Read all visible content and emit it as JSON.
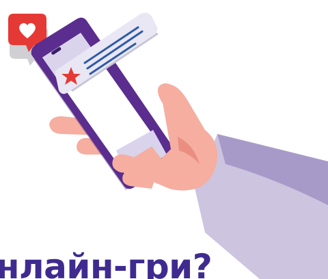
{
  "headline": {
    "text": "нлайн-гри?"
  },
  "colors": {
    "headline": "#3f2b8f",
    "phone_body": "#5b2d8e",
    "phone_screen": "#ffffff",
    "screen_shade": "#d9d4ec",
    "notification_card": "#e9e7f3",
    "notification_lines": "#2e5aa8",
    "star": "#e53935",
    "heart_bubble": "#e53935",
    "heart_bubble_shadow": "#cfcfd4",
    "hand": "#f5aea0",
    "hand_shadow": "#e98e80",
    "sleeve": "#cdc4e0",
    "sleeve_shadow": "#a89ac8"
  },
  "icons": {
    "star": "star-icon",
    "heart": "heart-icon"
  }
}
